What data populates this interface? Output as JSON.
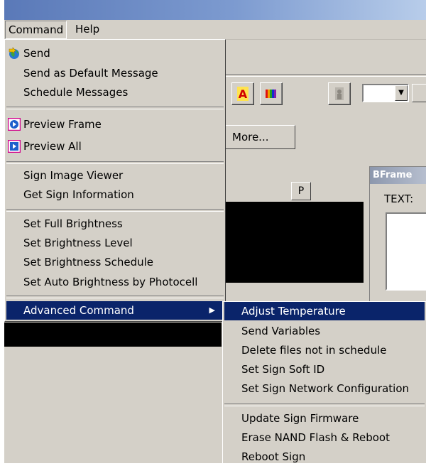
{
  "menubar": {
    "command": "Command",
    "help": "Help"
  },
  "background": {
    "more_label": "More...",
    "p_label": "P",
    "bframe_title": "BFrame",
    "text_label": "TEXT:"
  },
  "command_menu": {
    "send": "Send",
    "send_default": "Send as Default Message",
    "schedule": "Schedule Messages",
    "preview_frame": "Preview Frame",
    "preview_all": "Preview All",
    "sign_image_viewer": "Sign Image Viewer",
    "get_sign_info": "Get Sign Information",
    "full_brightness": "Set Full Brightness",
    "brightness_level": "Set Brightness Level",
    "brightness_schedule": "Set Brightness Schedule",
    "auto_brightness": "Set Auto Brightness by Photocell",
    "advanced": "Advanced Command"
  },
  "advanced_menu": {
    "adjust_temp": "Adjust Temperature",
    "send_vars": "Send Variables",
    "delete_files": "Delete files not in schedule",
    "soft_id": "Set Sign Soft ID",
    "network": "Set Sign Network Configuration",
    "firmware": "Update Sign Firmware",
    "erase_nand": "Erase NAND Flash &  Reboot",
    "reboot": "Reboot Sign"
  },
  "icons": {
    "send": "globe-send-icon",
    "preview_frame": "preview-frame-icon",
    "preview_all": "preview-all-icon",
    "text_tool": "text-a-icon",
    "color_bars": "color-bars-icon",
    "person": "person-icon"
  }
}
